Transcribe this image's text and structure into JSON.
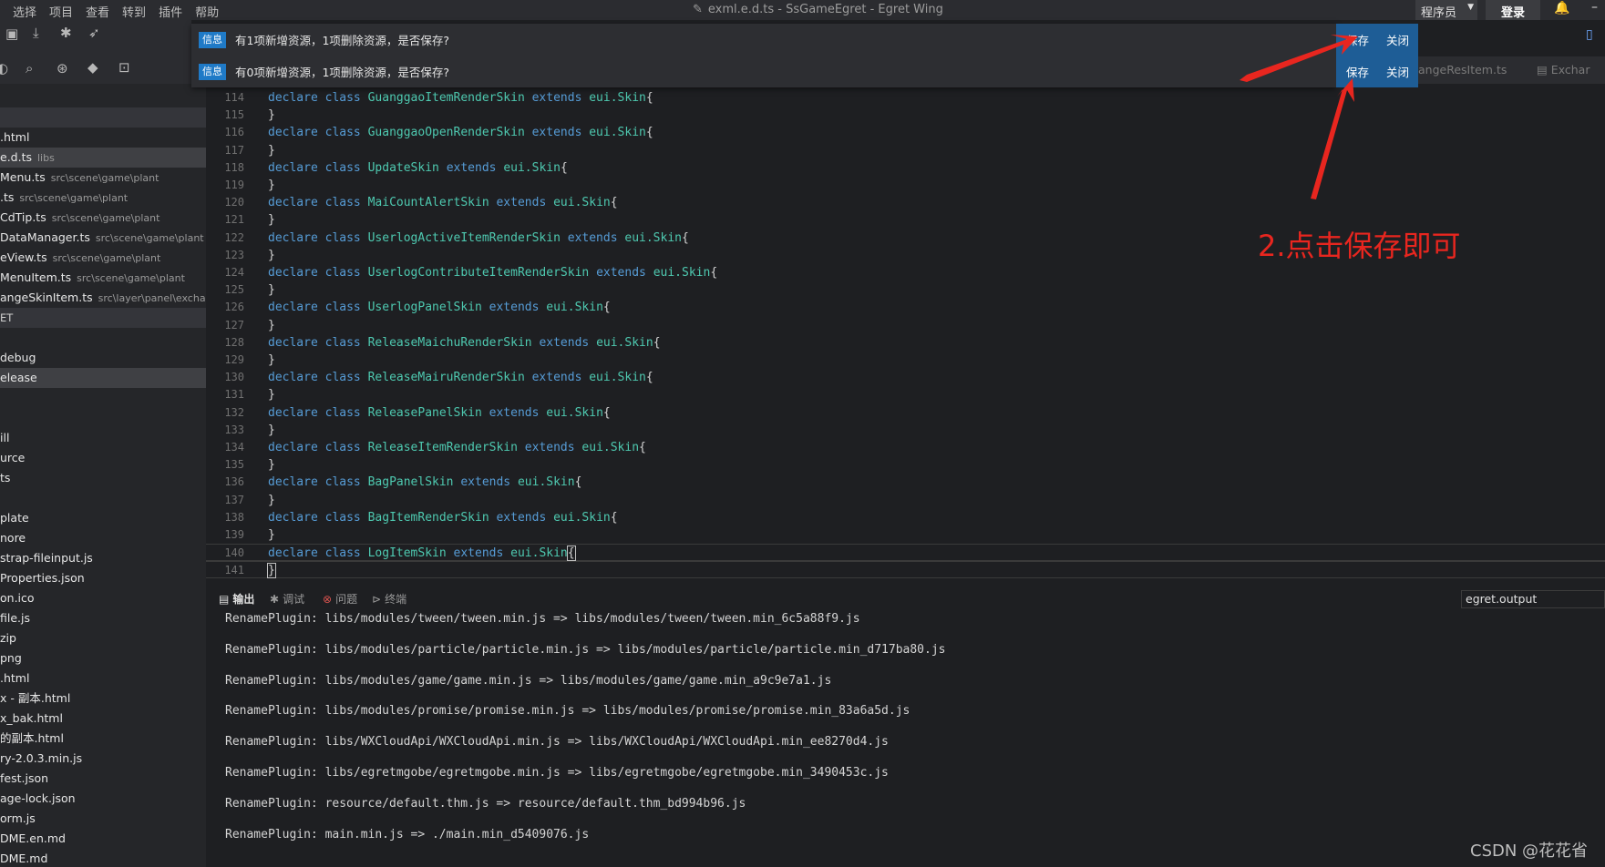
{
  "menu": [
    "选择",
    "项目",
    "查看",
    "转到",
    "插件",
    "帮助"
  ],
  "window_title": "exml.e.d.ts - SsGameEgret - Egret Wing",
  "header": {
    "role": "程序员",
    "login": "登录"
  },
  "notifications": [
    {
      "badge": "信息",
      "text": "有1项新增资源，1项删除资源，是否保存?",
      "save": "保存",
      "close": "关闭"
    },
    {
      "badge": "信息",
      "text": "有0项新增资源，1项删除资源，是否保存?",
      "save": "保存",
      "close": "关闭"
    }
  ],
  "editor_tabs": [
    "angeResItem.ts",
    "Exchar"
  ],
  "sidebar": [
    {
      "label": "",
      "path": "",
      "type": "hdr"
    },
    {
      "label": ".html",
      "path": "",
      "type": "file"
    },
    {
      "label": "e.d.ts",
      "path": "libs",
      "type": "sel"
    },
    {
      "label": "Menu.ts",
      "path": "src\\scene\\game\\plant",
      "type": "file"
    },
    {
      "label": ".ts",
      "path": "src\\scene\\game\\plant",
      "type": "file"
    },
    {
      "label": "CdTip.ts",
      "path": "src\\scene\\game\\plant",
      "type": "file"
    },
    {
      "label": "DataManager.ts",
      "path": "src\\scene\\game\\plant",
      "type": "file"
    },
    {
      "label": "eView.ts",
      "path": "src\\scene\\game\\plant",
      "type": "file"
    },
    {
      "label": "MenuItem.ts",
      "path": "src\\scene\\game\\plant",
      "type": "file"
    },
    {
      "label": "angeSkinItem.ts",
      "path": "src\\layer\\panel\\exchange",
      "type": "file"
    },
    {
      "label": "ET",
      "path": "",
      "type": "hdr"
    },
    {
      "label": "",
      "path": "",
      "type": "file"
    },
    {
      "label": "debug",
      "path": "",
      "type": "file"
    },
    {
      "label": "elease",
      "path": "",
      "type": "sel"
    },
    {
      "label": "",
      "path": "",
      "type": "file"
    },
    {
      "label": "",
      "path": "",
      "type": "file"
    },
    {
      "label": "ill",
      "path": "",
      "type": "file"
    },
    {
      "label": "urce",
      "path": "",
      "type": "file"
    },
    {
      "label": "ts",
      "path": "",
      "type": "file"
    },
    {
      "label": "",
      "path": "",
      "type": "file"
    },
    {
      "label": "plate",
      "path": "",
      "type": "file"
    },
    {
      "label": "nore",
      "path": "",
      "type": "file"
    },
    {
      "label": "strap-fileinput.js",
      "path": "",
      "type": "file"
    },
    {
      "label": "Properties.json",
      "path": "",
      "type": "file"
    },
    {
      "label": "on.ico",
      "path": "",
      "type": "file"
    },
    {
      "label": "file.js",
      "path": "",
      "type": "file"
    },
    {
      "label": "zip",
      "path": "",
      "type": "file"
    },
    {
      "label": "png",
      "path": "",
      "type": "file"
    },
    {
      "label": ".html",
      "path": "",
      "type": "file"
    },
    {
      "label": "x - 副本.html",
      "path": "",
      "type": "file"
    },
    {
      "label": "x_bak.html",
      "path": "",
      "type": "file"
    },
    {
      "label": "的副本.html",
      "path": "",
      "type": "file"
    },
    {
      "label": "ry-2.0.3.min.js",
      "path": "",
      "type": "file"
    },
    {
      "label": "fest.json",
      "path": "",
      "type": "file"
    },
    {
      "label": "age-lock.json",
      "path": "",
      "type": "file"
    },
    {
      "label": "orm.js",
      "path": "",
      "type": "file"
    },
    {
      "label": "DME.en.md",
      "path": "",
      "type": "file"
    },
    {
      "label": "DME.md",
      "path": "",
      "type": "file"
    }
  ],
  "code_lines": [
    {
      "n": "114",
      "decl": "GuanggaoItemRenderSkin"
    },
    {
      "n": "115",
      "close": true
    },
    {
      "n": "116",
      "decl": "GuanggaoOpenRenderSkin"
    },
    {
      "n": "117",
      "close": true
    },
    {
      "n": "118",
      "decl": "UpdateSkin"
    },
    {
      "n": "119",
      "close": true
    },
    {
      "n": "120",
      "decl": "MaiCountAlertSkin"
    },
    {
      "n": "121",
      "close": true
    },
    {
      "n": "122",
      "decl": "UserlogActiveItemRenderSkin"
    },
    {
      "n": "123",
      "close": true
    },
    {
      "n": "124",
      "decl": "UserlogContributeItemRenderSkin"
    },
    {
      "n": "125",
      "close": true
    },
    {
      "n": "126",
      "decl": "UserlogPanelSkin"
    },
    {
      "n": "127",
      "close": true
    },
    {
      "n": "128",
      "decl": "ReleaseMaichuRenderSkin"
    },
    {
      "n": "129",
      "close": true
    },
    {
      "n": "130",
      "decl": "ReleaseMairuRenderSkin"
    },
    {
      "n": "131",
      "close": true
    },
    {
      "n": "132",
      "decl": "ReleasePanelSkin"
    },
    {
      "n": "133",
      "close": true
    },
    {
      "n": "134",
      "decl": "ReleaseItemRenderSkin"
    },
    {
      "n": "135",
      "close": true
    },
    {
      "n": "136",
      "decl": "BagPanelSkin"
    },
    {
      "n": "137",
      "close": true
    },
    {
      "n": "138",
      "decl": "BagItemRenderSkin"
    },
    {
      "n": "139",
      "close": true
    },
    {
      "n": "140",
      "decl": "LogItemSkin",
      "current": true
    },
    {
      "n": "141",
      "close": true,
      "current": true
    }
  ],
  "code_tokens": {
    "declare": "declare",
    "class": "class",
    "extends": "extends",
    "base": "eui.Skin",
    "open": "{",
    "close": "}"
  },
  "panel": {
    "tabs": [
      "输出",
      "调试",
      "问题",
      "终端"
    ],
    "output_channel": "egret.output"
  },
  "output_lines": [
    "RenamePlugin: libs/modules/tween/tween.min.js => libs/modules/tween/tween.min_6c5a88f9.js",
    "RenamePlugin: libs/modules/particle/particle.min.js => libs/modules/particle/particle.min_d717ba80.js",
    "RenamePlugin: libs/modules/game/game.min.js => libs/modules/game/game.min_a9c9e7a1.js",
    "RenamePlugin: libs/modules/promise/promise.min.js => libs/modules/promise/promise.min_83a6a5d.js",
    "RenamePlugin: libs/WXCloudApi/WXCloudApi.min.js => libs/WXCloudApi/WXCloudApi.min_ee8270d4.js",
    "RenamePlugin: libs/egretmgobe/egretmgobe.min.js => libs/egretmgobe/egretmgobe.min_3490453c.js",
    "RenamePlugin: resource/default.thm.js => resource/default.thm_bd994b96.js",
    "RenamePlugin: main.min.js => ./main.min_d5409076.js"
  ],
  "annotation": "2.点击保存即可",
  "watermark": "CSDN @花花省",
  "colors": {
    "annotation_red": "#e8261f",
    "notify_action_bg": "#1e5d96",
    "badge_blue": "#1f7ac7"
  }
}
